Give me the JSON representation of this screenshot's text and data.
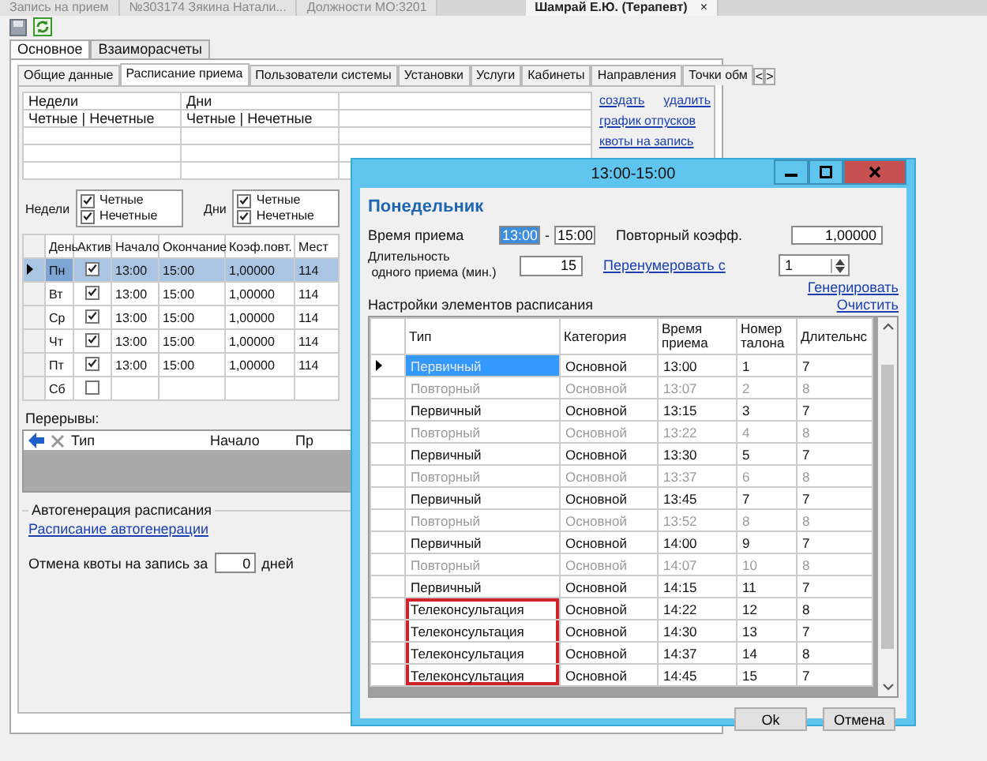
{
  "doc_tabs": [
    {
      "label": "Запись на прием",
      "selected": false
    },
    {
      "label": "№303174 Зякина Натали...",
      "selected": false
    },
    {
      "label": "Должности МО:3201",
      "selected": false
    },
    {
      "label": "Шамрай Е.Ю. (Терапевт)",
      "selected": true,
      "close": "×"
    }
  ],
  "main_tabs": [
    {
      "label": "Основное",
      "selected": true
    },
    {
      "label": "Взаиморасчеты",
      "selected": false
    }
  ],
  "sub_tabs": [
    {
      "label": "Общие данные",
      "selected": false
    },
    {
      "label": "Расписание приема",
      "selected": true
    },
    {
      "label": "Пользователи системы",
      "selected": false
    },
    {
      "label": "Установки",
      "selected": false
    },
    {
      "label": "Услуги",
      "selected": false
    },
    {
      "label": "Кабинеты",
      "selected": false
    },
    {
      "label": "Направления",
      "selected": false
    },
    {
      "label": "Точки обм",
      "selected": false
    }
  ],
  "sub_tab_scroll": [
    "<",
    ">"
  ],
  "schedules": {
    "columns": [
      "Недели",
      "Дни"
    ],
    "rows": [
      [
        "Четные | Нечетные",
        "Четные | Нечетные"
      ]
    ]
  },
  "schedule_links": [
    "создать",
    "удалить",
    "график отпусков",
    "квоты на запись"
  ],
  "week_filter": {
    "label": "Недели",
    "options": [
      {
        "label": "Четные",
        "checked": true
      },
      {
        "label": "Нечетные",
        "checked": true
      }
    ]
  },
  "day_filter": {
    "label": "Дни",
    "options": [
      {
        "label": "Четные",
        "checked": true
      },
      {
        "label": "Нечетные",
        "checked": true
      }
    ]
  },
  "days_table": {
    "columns": [
      "День",
      "Актив",
      "Начало",
      "Окончание",
      "Коэф.повт.",
      "Мест"
    ],
    "rows": [
      {
        "day": "Пн",
        "active": true,
        "start": "13:00",
        "end": "15:00",
        "coef": "1,00000",
        "place": "114",
        "selected": true
      },
      {
        "day": "Вт",
        "active": true,
        "start": "13:00",
        "end": "15:00",
        "coef": "1,00000",
        "place": "114",
        "selected": false
      },
      {
        "day": "Ср",
        "active": true,
        "start": "13:00",
        "end": "15:00",
        "coef": "1,00000",
        "place": "114",
        "selected": false
      },
      {
        "day": "Чт",
        "active": true,
        "start": "13:00",
        "end": "15:00",
        "coef": "1,00000",
        "place": "114",
        "selected": false
      },
      {
        "day": "Пт",
        "active": true,
        "start": "13:00",
        "end": "15:00",
        "coef": "1,00000",
        "place": "114",
        "selected": false
      },
      {
        "day": "Сб",
        "active": false,
        "selected": false
      }
    ]
  },
  "breaks": {
    "label": "Перерывы:",
    "columns": [
      "Тип",
      "Начало",
      "Пр"
    ]
  },
  "autogen": {
    "title": "Автогенерация расписания",
    "link": "Расписание автогенерации",
    "quota_label": "Отмена квоты на запись за",
    "quota_value": "0",
    "quota_unit": "дней"
  },
  "dialog": {
    "title": "13:00-15:00",
    "heading": "Понедельник",
    "time_label": "Время приема",
    "time_from": "13:00",
    "time_sep": "-",
    "time_to": "15:00",
    "coef_label": "Повторный коэфф.",
    "coef_value": "1,00000",
    "duration_label": "Длительность",
    "duration_label_2": "одного приема (мин.)",
    "duration_value": "15",
    "renumber_link": "Перенумеровать с",
    "renumber_value": "1",
    "generate_link": "Генерировать",
    "settings_label": "Настройки элементов расписания",
    "clear_link": "Очистить",
    "columns": [
      "Тип",
      "Категория",
      "Время приема",
      "Номер талона",
      "Длительнс"
    ],
    "rows": [
      {
        "type": "Первичный",
        "category": "Основной",
        "time": "13:00",
        "number": "1",
        "duration": "7",
        "muted": false,
        "selected": true,
        "highlighted": false
      },
      {
        "type": "Повторный",
        "category": "Основной",
        "time": "13:07",
        "number": "2",
        "duration": "8",
        "muted": true,
        "selected": false,
        "highlighted": false
      },
      {
        "type": "Первичный",
        "category": "Основной",
        "time": "13:15",
        "number": "3",
        "duration": "7",
        "muted": false,
        "selected": false,
        "highlighted": false
      },
      {
        "type": "Повторный",
        "category": "Основной",
        "time": "13:22",
        "number": "4",
        "duration": "8",
        "muted": true,
        "selected": false,
        "highlighted": false
      },
      {
        "type": "Первичный",
        "category": "Основной",
        "time": "13:30",
        "number": "5",
        "duration": "7",
        "muted": false,
        "selected": false,
        "highlighted": false
      },
      {
        "type": "Повторный",
        "category": "Основной",
        "time": "13:37",
        "number": "6",
        "duration": "8",
        "muted": true,
        "selected": false,
        "highlighted": false
      },
      {
        "type": "Первичный",
        "category": "Основной",
        "time": "13:45",
        "number": "7",
        "duration": "7",
        "muted": false,
        "selected": false,
        "highlighted": false
      },
      {
        "type": "Повторный",
        "category": "Основной",
        "time": "13:52",
        "number": "8",
        "duration": "8",
        "muted": true,
        "selected": false,
        "highlighted": false
      },
      {
        "type": "Первичный",
        "category": "Основной",
        "time": "14:00",
        "number": "9",
        "duration": "7",
        "muted": false,
        "selected": false,
        "highlighted": false
      },
      {
        "type": "Повторный",
        "category": "Основной",
        "time": "14:07",
        "number": "10",
        "duration": "8",
        "muted": true,
        "selected": false,
        "highlighted": false
      },
      {
        "type": "Первичный",
        "category": "Основной",
        "time": "14:15",
        "number": "11",
        "duration": "7",
        "muted": false,
        "selected": false,
        "highlighted": false
      },
      {
        "type": "Телеконсультация",
        "category": "Основной",
        "time": "14:22",
        "number": "12",
        "duration": "8",
        "muted": false,
        "selected": false,
        "highlighted": true
      },
      {
        "type": "Телеконсультация",
        "category": "Основной",
        "time": "14:30",
        "number": "13",
        "duration": "7",
        "muted": false,
        "selected": false,
        "highlighted": true
      },
      {
        "type": "Телеконсультация",
        "category": "Основной",
        "time": "14:37",
        "number": "14",
        "duration": "8",
        "muted": false,
        "selected": false,
        "highlighted": true
      },
      {
        "type": "Телеконсультация",
        "category": "Основной",
        "time": "14:45",
        "number": "15",
        "duration": "7",
        "muted": false,
        "selected": false,
        "highlighted": true
      }
    ],
    "buttons": [
      "Ok",
      "Отмена"
    ]
  }
}
